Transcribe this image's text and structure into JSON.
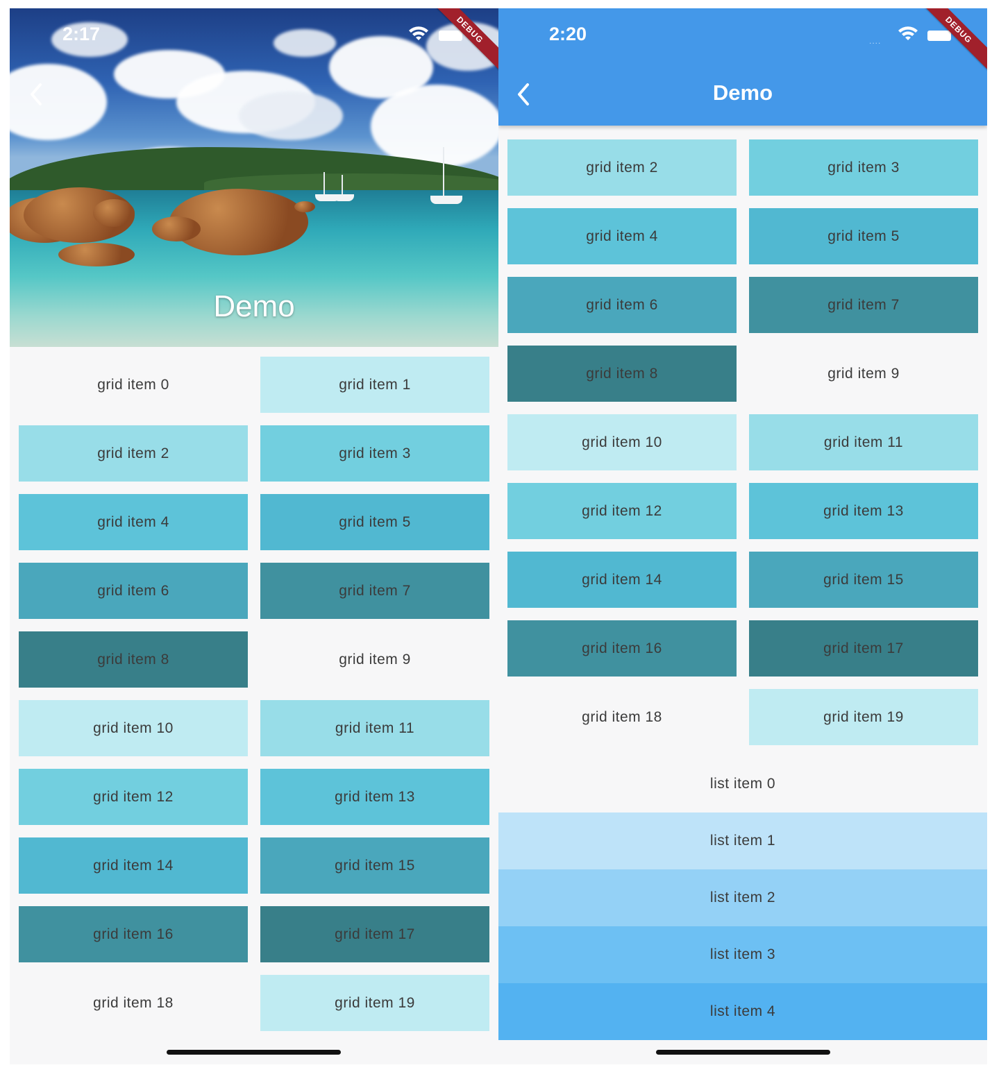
{
  "left_screen": {
    "status_time": "2:17",
    "debug_label": "DEBUG",
    "title": "Demo",
    "grid_items": [
      {
        "label": "grid item 0",
        "color": "#f7f7f8"
      },
      {
        "label": "grid item 1",
        "color": "#bfebf2"
      },
      {
        "label": "grid item 2",
        "color": "#98dde8"
      },
      {
        "label": "grid item 3",
        "color": "#72cfdf"
      },
      {
        "label": "grid item 4",
        "color": "#5dc3d9"
      },
      {
        "label": "grid item 5",
        "color": "#51b8d1"
      },
      {
        "label": "grid item 6",
        "color": "#4aa7bc"
      },
      {
        "label": "grid item 7",
        "color": "#40919f"
      },
      {
        "label": "grid item 8",
        "color": "#387f89"
      },
      {
        "label": "grid item 9",
        "color": "#f7f7f8"
      },
      {
        "label": "grid item 10",
        "color": "#bfebf2"
      },
      {
        "label": "grid item 11",
        "color": "#98dde8"
      },
      {
        "label": "grid item 12",
        "color": "#72cfdf"
      },
      {
        "label": "grid item 13",
        "color": "#5dc3d9"
      },
      {
        "label": "grid item 14",
        "color": "#51b8d1"
      },
      {
        "label": "grid item 15",
        "color": "#4aa7bc"
      },
      {
        "label": "grid item 16",
        "color": "#40919f"
      },
      {
        "label": "grid item 17",
        "color": "#387f89"
      },
      {
        "label": "grid item 18",
        "color": "#f7f7f8"
      },
      {
        "label": "grid item 19",
        "color": "#bfebf2"
      }
    ]
  },
  "right_screen": {
    "status_time": "2:20",
    "debug_label": "DEBUG",
    "title": "Demo",
    "appbar_color": "#4498e9",
    "grid_items": [
      {
        "label": "grid item 2",
        "color": "#98dde8"
      },
      {
        "label": "grid item 3",
        "color": "#72cfdf"
      },
      {
        "label": "grid item 4",
        "color": "#5dc3d9"
      },
      {
        "label": "grid item 5",
        "color": "#51b8d1"
      },
      {
        "label": "grid item 6",
        "color": "#4aa7bc"
      },
      {
        "label": "grid item 7",
        "color": "#40919f"
      },
      {
        "label": "grid item 8",
        "color": "#387f89"
      },
      {
        "label": "grid item 9",
        "color": "#f7f7f8"
      },
      {
        "label": "grid item 10",
        "color": "#bfebf2"
      },
      {
        "label": "grid item 11",
        "color": "#98dde8"
      },
      {
        "label": "grid item 12",
        "color": "#72cfdf"
      },
      {
        "label": "grid item 13",
        "color": "#5dc3d9"
      },
      {
        "label": "grid item 14",
        "color": "#51b8d1"
      },
      {
        "label": "grid item 15",
        "color": "#4aa7bc"
      },
      {
        "label": "grid item 16",
        "color": "#40919f"
      },
      {
        "label": "grid item 17",
        "color": "#387f89"
      },
      {
        "label": "grid item 18",
        "color": "#f7f7f8"
      },
      {
        "label": "grid item 19",
        "color": "#bfebf2"
      }
    ],
    "list_items": [
      {
        "label": "list item 0",
        "color": "#f7f7f8"
      },
      {
        "label": "list item 1",
        "color": "#bee3f9"
      },
      {
        "label": "list item 2",
        "color": "#94d1f6"
      },
      {
        "label": "list item 3",
        "color": "#6dc0f3"
      },
      {
        "label": "list item 4",
        "color": "#53b2f1"
      }
    ]
  }
}
